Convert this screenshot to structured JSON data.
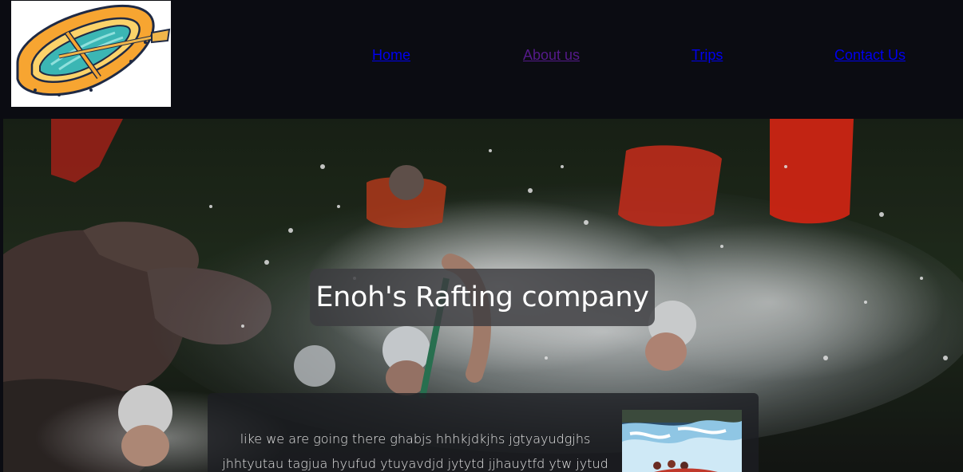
{
  "header": {
    "logo_icon": "raft-logo-icon",
    "nav": [
      {
        "label": "Home"
      },
      {
        "label": "About us"
      },
      {
        "label": "Trips"
      },
      {
        "label": "Contact Us"
      }
    ]
  },
  "hero": {
    "background_icon": "rafting-splash-photo",
    "title": "Enoh's Rafting company",
    "intro_lines": [
      "like we are going there ghabjs hhhkjdkjhs jgtyayudgjhs",
      "jhhtyutau tagjua hyufud ytuyavdjd jytytd jjhauytfd ytw jytud"
    ],
    "thumbnail_icon": "whitewater-thumbnail-photo"
  },
  "colors": {
    "page_bg": "#0b0c12",
    "link": "#0000ee",
    "link_visited": "#551a8b",
    "title_box_bg": "#3c3c40",
    "text_light": "#ffffff"
  }
}
